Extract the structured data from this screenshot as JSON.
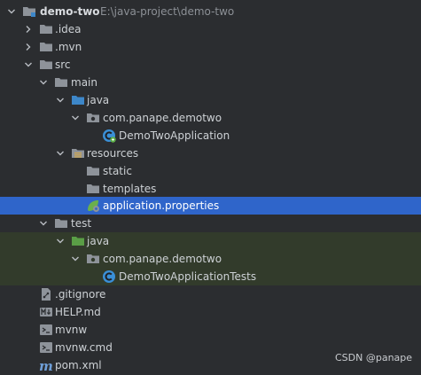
{
  "project": {
    "name": "demo-two",
    "path": "E:\\java-project\\demo-two"
  },
  "tree": {
    "idea": ".idea",
    "mvn": ".mvn",
    "src": "src",
    "main": "main",
    "main_java": "java",
    "main_package": "com.panape.demotwo",
    "main_class": "DemoTwoApplication",
    "resources": "resources",
    "static": "static",
    "templates": "templates",
    "app_properties": "application.properties",
    "test": "test",
    "test_java": "java",
    "test_package": "com.panape.demotwo",
    "test_class": "DemoTwoApplicationTests",
    "gitignore": ".gitignore",
    "help": "HELP.md",
    "mvnw": "mvnw",
    "mvnw_cmd": "mvnw.cmd",
    "pom": "pom.xml"
  },
  "selected_item": "application.properties",
  "watermark": "CSDN @panape",
  "colors": {
    "background": "#2b2d30",
    "selection": "#2f65ca",
    "test_highlight": "#323b2b",
    "folder": "#8e939a",
    "source_folder": "#3d87c9",
    "test_folder": "#5a9e46",
    "class_icon": "#3a8fd6"
  }
}
